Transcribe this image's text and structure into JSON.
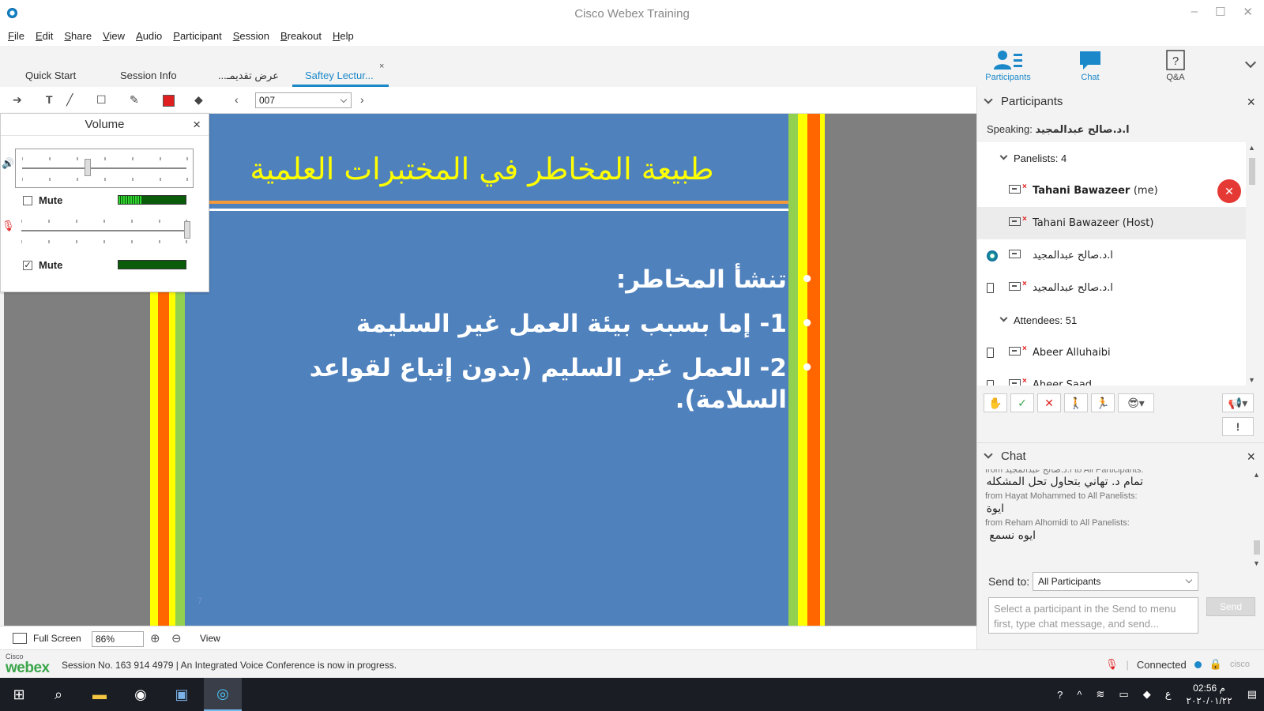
{
  "window": {
    "title": "Cisco Webex Training",
    "min": "–",
    "max": "☐",
    "close": "✕"
  },
  "menu": [
    "File",
    "Edit",
    "Share",
    "View",
    "Audio",
    "Participant",
    "Session",
    "Breakout",
    "Help"
  ],
  "tabs": [
    {
      "label": "Quick Start"
    },
    {
      "label": "Session Info"
    },
    {
      "label": "عرض تقديمـ..."
    },
    {
      "label": "Saftey Lectur...",
      "active": true
    }
  ],
  "tab_close": "×",
  "panel_buttons": {
    "participants": "Participants",
    "chat": "Chat",
    "qa": "Q&A"
  },
  "annotation": {
    "page": "007"
  },
  "slide": {
    "title": "طبيعة المخاطر في المختبرات العلمية",
    "bullets": [
      "تنشأ المخاطر:",
      "1- إما بسبب بيئة العمل غير السليمة",
      "2- العمل غير السليم (بدون إتباع لقواعد السلامة)."
    ],
    "number": "7"
  },
  "volume": {
    "title": "Volume",
    "close": "×",
    "speaker": {
      "level": 0.4,
      "mute_label": "Mute",
      "muted": false,
      "meter_fill": 0.35
    },
    "mic": {
      "level": 1.0,
      "mute_label": "Mute",
      "muted": true,
      "meter_fill": 0.0
    }
  },
  "bottom": {
    "full_screen": "Full Screen",
    "zoom": "86%",
    "view": "View"
  },
  "status": {
    "cisco": "Cisco",
    "webex": "webex",
    "text": "Session No. 163 914 4979  |  An Integrated Voice Conference is now in progress.",
    "connected": "Connected",
    "cisco_logo": "cisco"
  },
  "participants": {
    "header": "Participants",
    "speaking_label": "Speaking:",
    "speaking_name": "ا.د.صالح عبدالمجيد",
    "panelists_label": "Panelists: 4",
    "attendees_label": "Attendees: 51",
    "panelists": [
      {
        "name": "Tahani Bawazeer",
        "suffix": "(me)",
        "bold": true,
        "mic_muted": true
      },
      {
        "name": "Tahani Bawazeer (Host)",
        "highlight": true
      },
      {
        "name": "ا.د.صالح عبدالمجيد",
        "lead": "webex"
      },
      {
        "name": "ا.د.صالح عبدالمجيد",
        "lead": "phone"
      }
    ],
    "attendees": [
      {
        "name": "Abeer Alluhaibi",
        "lead": "phone"
      },
      {
        "name": "Aheer Saad",
        "lead": "phone"
      }
    ]
  },
  "chat": {
    "header": "Chat",
    "messages": [
      {
        "from": "from ا.د.صالح عبدالمجيد to All Participants:",
        "text": ""
      },
      {
        "from": "",
        "text": "تمام د. تهاني بتحاول تحل المشكله"
      },
      {
        "from": "from Hayat Mohammed to All Panelists:",
        "text": "ايوة"
      },
      {
        "from": "from Reham Alhomidi to All Panelists:",
        "text": "ايوه نسمع"
      }
    ],
    "send_to_label": "Send to:",
    "send_to_value": "All Participants",
    "input_placeholder": "Select a participant in the Send to menu first, type chat message, and send...",
    "send_button": "Send"
  },
  "taskbar": {
    "time": "02:56 م",
    "date": "٢٠٢٠/٠١/٢٢",
    "lang": "ع"
  }
}
